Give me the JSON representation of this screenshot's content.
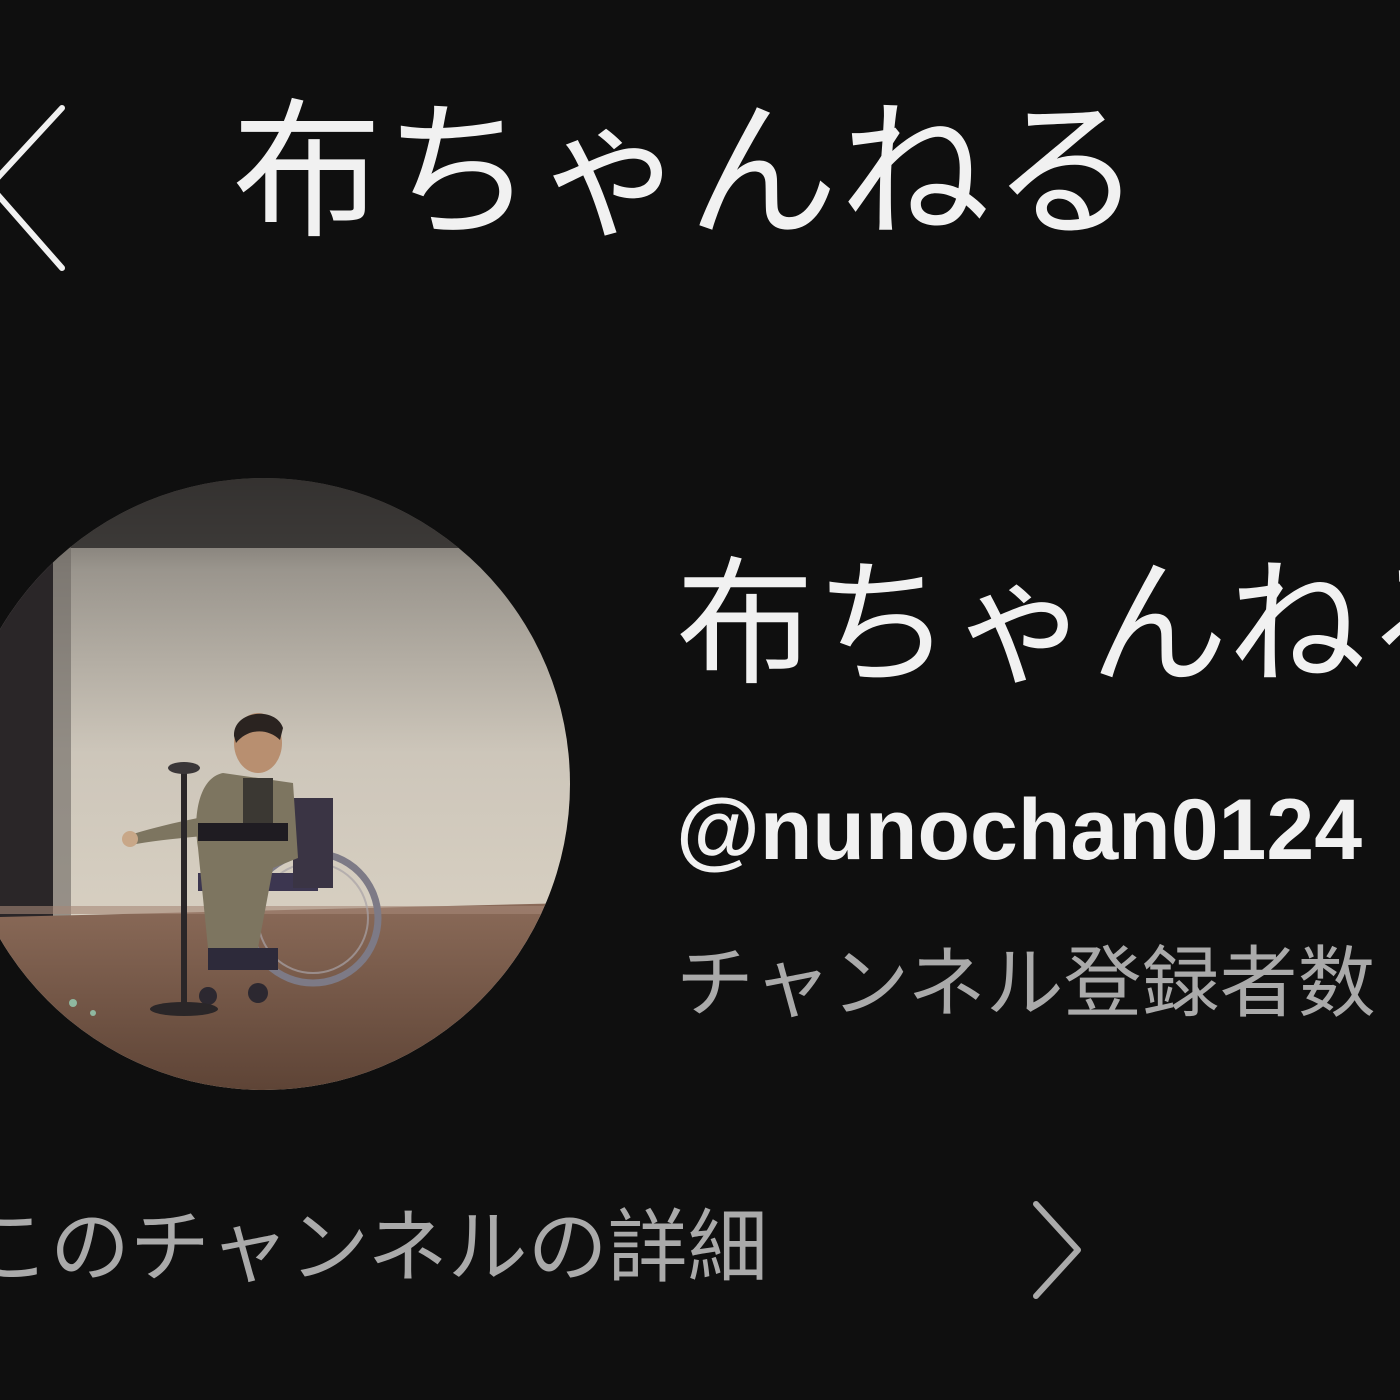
{
  "header": {
    "back_icon": "chevron-left-icon",
    "title": "布ちゃんねる"
  },
  "channel": {
    "name": "布ちゃんねる",
    "handle": "@nunochan0124",
    "subscribers": "チャンネル登録者数",
    "avatar_description": "avatar-image"
  },
  "details": {
    "label": "このチャンネルの詳細",
    "icon": "chevron-right-icon"
  },
  "colors": {
    "background": "#0f0f0f",
    "primary_text": "#f1f1f1",
    "secondary_text": "#aaaaaa"
  }
}
